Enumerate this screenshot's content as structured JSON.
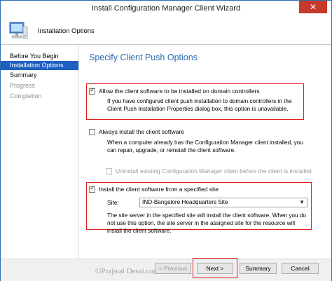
{
  "window": {
    "title": "Install Configuration Manager Client Wizard",
    "close_glyph": "✕"
  },
  "banner": {
    "title": "Installation Options",
    "icon": "computer-icon"
  },
  "sidebar": {
    "items": [
      {
        "label": "Before You Begin",
        "state": "normal"
      },
      {
        "label": "Installation Options",
        "state": "active"
      },
      {
        "label": "Summary",
        "state": "normal"
      },
      {
        "label": "Progress",
        "state": "dim"
      },
      {
        "label": "Completion",
        "state": "dim"
      }
    ]
  },
  "main": {
    "title": "Specify Client Push Options",
    "option_dc": {
      "label": "Allow the client software to be installed on domain controllers",
      "checked": true,
      "description": "If you have configured client push installation to domain controllers in the Client Push Installation Properties dialog box, this option is unavailable."
    },
    "option_always": {
      "label": "Always install the client software",
      "checked": false,
      "description": "When a computer already has the Configuration Manager client installed, you can repair, upgrade, or reinstall the client software."
    },
    "option_uninstall": {
      "label": "Uninstall existing Configuration Manager client before the client is installed",
      "checked": false,
      "disabled": true
    },
    "option_site": {
      "label": "Install the client software from a specified site",
      "checked": true,
      "site_label": "Site:",
      "site_value": "IND-Bangalore Headquarters Site",
      "description": "The site server in the specified site will install the client software.  When you do not use this option, the site server in the assigned site for the resource will install the client software."
    }
  },
  "footer": {
    "previous": "< Previous",
    "next": "Next >",
    "summary": "Summary",
    "cancel": "Cancel",
    "watermark": "©Prajwal Desai.com"
  },
  "colors": {
    "accent": "#1e5fc2",
    "title_blue": "#2b6cb3",
    "highlight": "#e02020"
  }
}
